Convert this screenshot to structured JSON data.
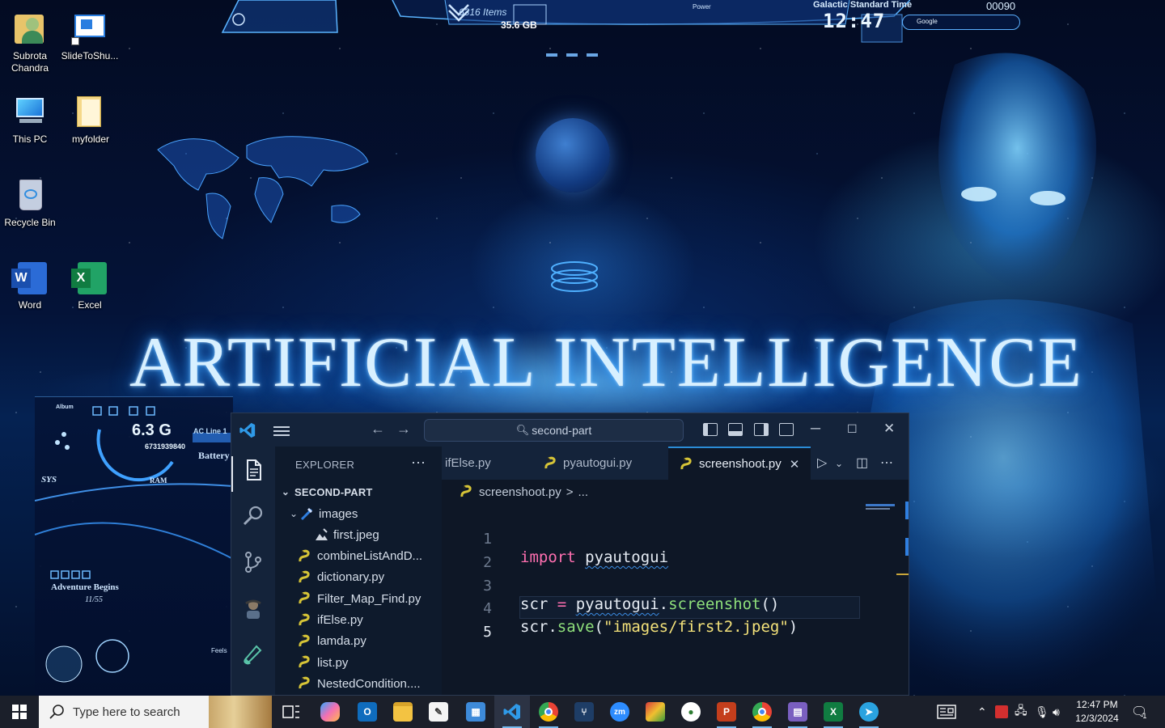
{
  "desktop": {
    "icons": [
      {
        "label": "Subrota Chandra",
        "icon": "user-folder-icon"
      },
      {
        "label": "SlideToShu...",
        "icon": "shortcut-icon"
      },
      {
        "label": "This PC",
        "icon": "this-pc-icon"
      },
      {
        "label": "myfolder",
        "icon": "folder-icon"
      },
      {
        "label": "Recycle Bin",
        "icon": "recycle-bin-icon"
      },
      {
        "label": "Word",
        "icon": "word-icon"
      },
      {
        "label": "Excel",
        "icon": "excel-icon"
      }
    ],
    "wallpaper_title": "ARTIFICIAL INTELLIGENCE"
  },
  "hud_top": {
    "items_count": "6316 Items",
    "size": "35.6 GB",
    "power_label": "Power",
    "clock_label": "Galactic Standard Time",
    "clock_time": "12:47",
    "search_text": "Google",
    "score": "00090"
  },
  "hud_left": {
    "album": "Album",
    "value": "6.3 G",
    "serial": "6731939840",
    "ac_line": "AC Line 1",
    "battery": "Battery",
    "sys": "SYS",
    "ram": "RAM",
    "adventure": "Adventure Begins",
    "date": "11/55",
    "feels": "Feels"
  },
  "vscode": {
    "search": "second-part",
    "explorer_title": "EXPLORER",
    "root_folder": "SECOND-PART",
    "tree": [
      {
        "label": "images",
        "type": "folder",
        "indent": 1
      },
      {
        "label": "first.jpeg",
        "type": "image",
        "indent": 2
      },
      {
        "label": "combineListAndD...",
        "type": "py",
        "indent": 1
      },
      {
        "label": "dictionary.py",
        "type": "py",
        "indent": 1
      },
      {
        "label": "Filter_Map_Find.py",
        "type": "py",
        "indent": 1
      },
      {
        "label": "ifElse.py",
        "type": "py",
        "indent": 1
      },
      {
        "label": "lamda.py",
        "type": "py",
        "indent": 1
      },
      {
        "label": "list.py",
        "type": "py",
        "indent": 1
      },
      {
        "label": "NestedCondition....",
        "type": "py",
        "indent": 1
      }
    ],
    "tabs": [
      {
        "label": "ifElse.py",
        "active": false
      },
      {
        "label": "pyautogui.py",
        "active": false
      },
      {
        "label": "screenshoot.py",
        "active": true
      }
    ],
    "breadcrumb": {
      "file": "screenshoot.py",
      "sep": ">",
      "rest": "..."
    },
    "line_numbers": [
      "1",
      "2",
      "3",
      "4",
      "5"
    ],
    "code": {
      "l1_kw": "import",
      "l1_mod": "pyautogui",
      "l3_var": "scr",
      "l3_op": "=",
      "l3_mod": "pyautogui",
      "l3_dot": ".",
      "l3_fn": "screenshot",
      "l3_paren": "()",
      "l4_var": "scr",
      "l4_dot": ".",
      "l4_fn": "save",
      "l4_open": "(",
      "l4_str": "\"images/first2.jpeg\"",
      "l4_close": ")"
    }
  },
  "taskbar": {
    "search_placeholder": "Type here to search",
    "apps": [
      "task-view",
      "copilot",
      "outlook",
      "file-explorer",
      "whiteboard",
      "control-panel",
      "vscode",
      "chrome",
      "git-tool",
      "zoom",
      "winrar",
      "vpn-app",
      "powerpoint",
      "chrome-profile",
      "app-switcher",
      "excel",
      "telegram"
    ],
    "time": "12:47 PM",
    "date": "12/3/2024",
    "notification_count": "1"
  }
}
